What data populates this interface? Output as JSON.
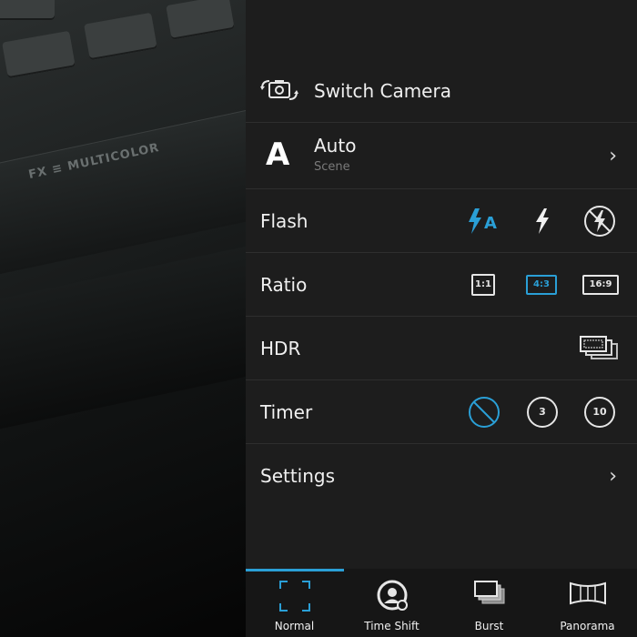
{
  "camera_menu": {
    "switch_camera_label": "Switch Camera",
    "scene": {
      "letter": "A",
      "title": "Auto",
      "subtitle": "Scene"
    },
    "flash": {
      "label": "Flash",
      "options": [
        "auto",
        "on",
        "off"
      ],
      "selected": "auto"
    },
    "ratio": {
      "label": "Ratio",
      "options": [
        "1:1",
        "4:3",
        "16:9"
      ],
      "selected": "4:3"
    },
    "hdr": {
      "label": "HDR"
    },
    "timer": {
      "label": "Timer",
      "options": [
        "off",
        "3",
        "10"
      ],
      "selected": "off"
    },
    "settings_label": "Settings"
  },
  "modes": [
    {
      "label": "Normal",
      "icon": "normal-frame-icon",
      "active": true
    },
    {
      "label": "Time Shift",
      "icon": "time-shift-icon",
      "active": false
    },
    {
      "label": "Burst",
      "icon": "burst-icon",
      "active": false
    },
    {
      "label": "Panorama",
      "icon": "panorama-icon",
      "active": false
    }
  ],
  "preview": {
    "device_text": "FX ≡ MULTICOLOR"
  },
  "colors": {
    "accent": "#2a9fd6",
    "panel": "#1d1d1d",
    "divider": "#2e2e2e",
    "text": "#f0f0f0"
  }
}
